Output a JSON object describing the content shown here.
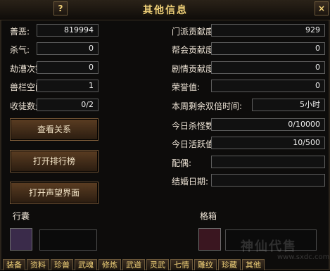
{
  "title": "其他信息",
  "help_label": "?",
  "close_label": "×",
  "left_fields": [
    {
      "label": "善恶:",
      "value": "819994"
    },
    {
      "label": "杀气:",
      "value": "0"
    },
    {
      "label": "劫漕次数:",
      "value": "0"
    },
    {
      "label": "兽栏空间:",
      "value": "1"
    },
    {
      "label": "收徒数量:",
      "value": "0/2"
    }
  ],
  "right_fields": [
    {
      "label": "门派贡献度:",
      "value": "929"
    },
    {
      "label": "帮会贡献度:",
      "value": "0"
    },
    {
      "label": "剧情贡献度:",
      "value": "0"
    },
    {
      "label": "荣誉值:",
      "value": "0"
    },
    {
      "label": "本周剩余双倍时间:",
      "value": "5小时"
    },
    {
      "label": "今日杀怪数:",
      "value": "0/10000"
    },
    {
      "label": "今日活跃值:",
      "value": "10/500"
    },
    {
      "label": "配偶:",
      "value": ""
    },
    {
      "label": "结婚日期:",
      "value": ""
    }
  ],
  "buttons": {
    "view_relations": "查看关系",
    "open_ranking": "打开排行榜",
    "open_reputation": "打开声望界面"
  },
  "sections": {
    "bag": "行囊",
    "grid": "格箱"
  },
  "watermark": {
    "text": "神仙代售",
    "url": "www.sxdc.com"
  },
  "tabs": [
    "装备",
    "资料",
    "珍兽",
    "武魂",
    "修炼",
    "武道",
    "灵武",
    "七情",
    "雕纹",
    "珍藏",
    "其他"
  ]
}
